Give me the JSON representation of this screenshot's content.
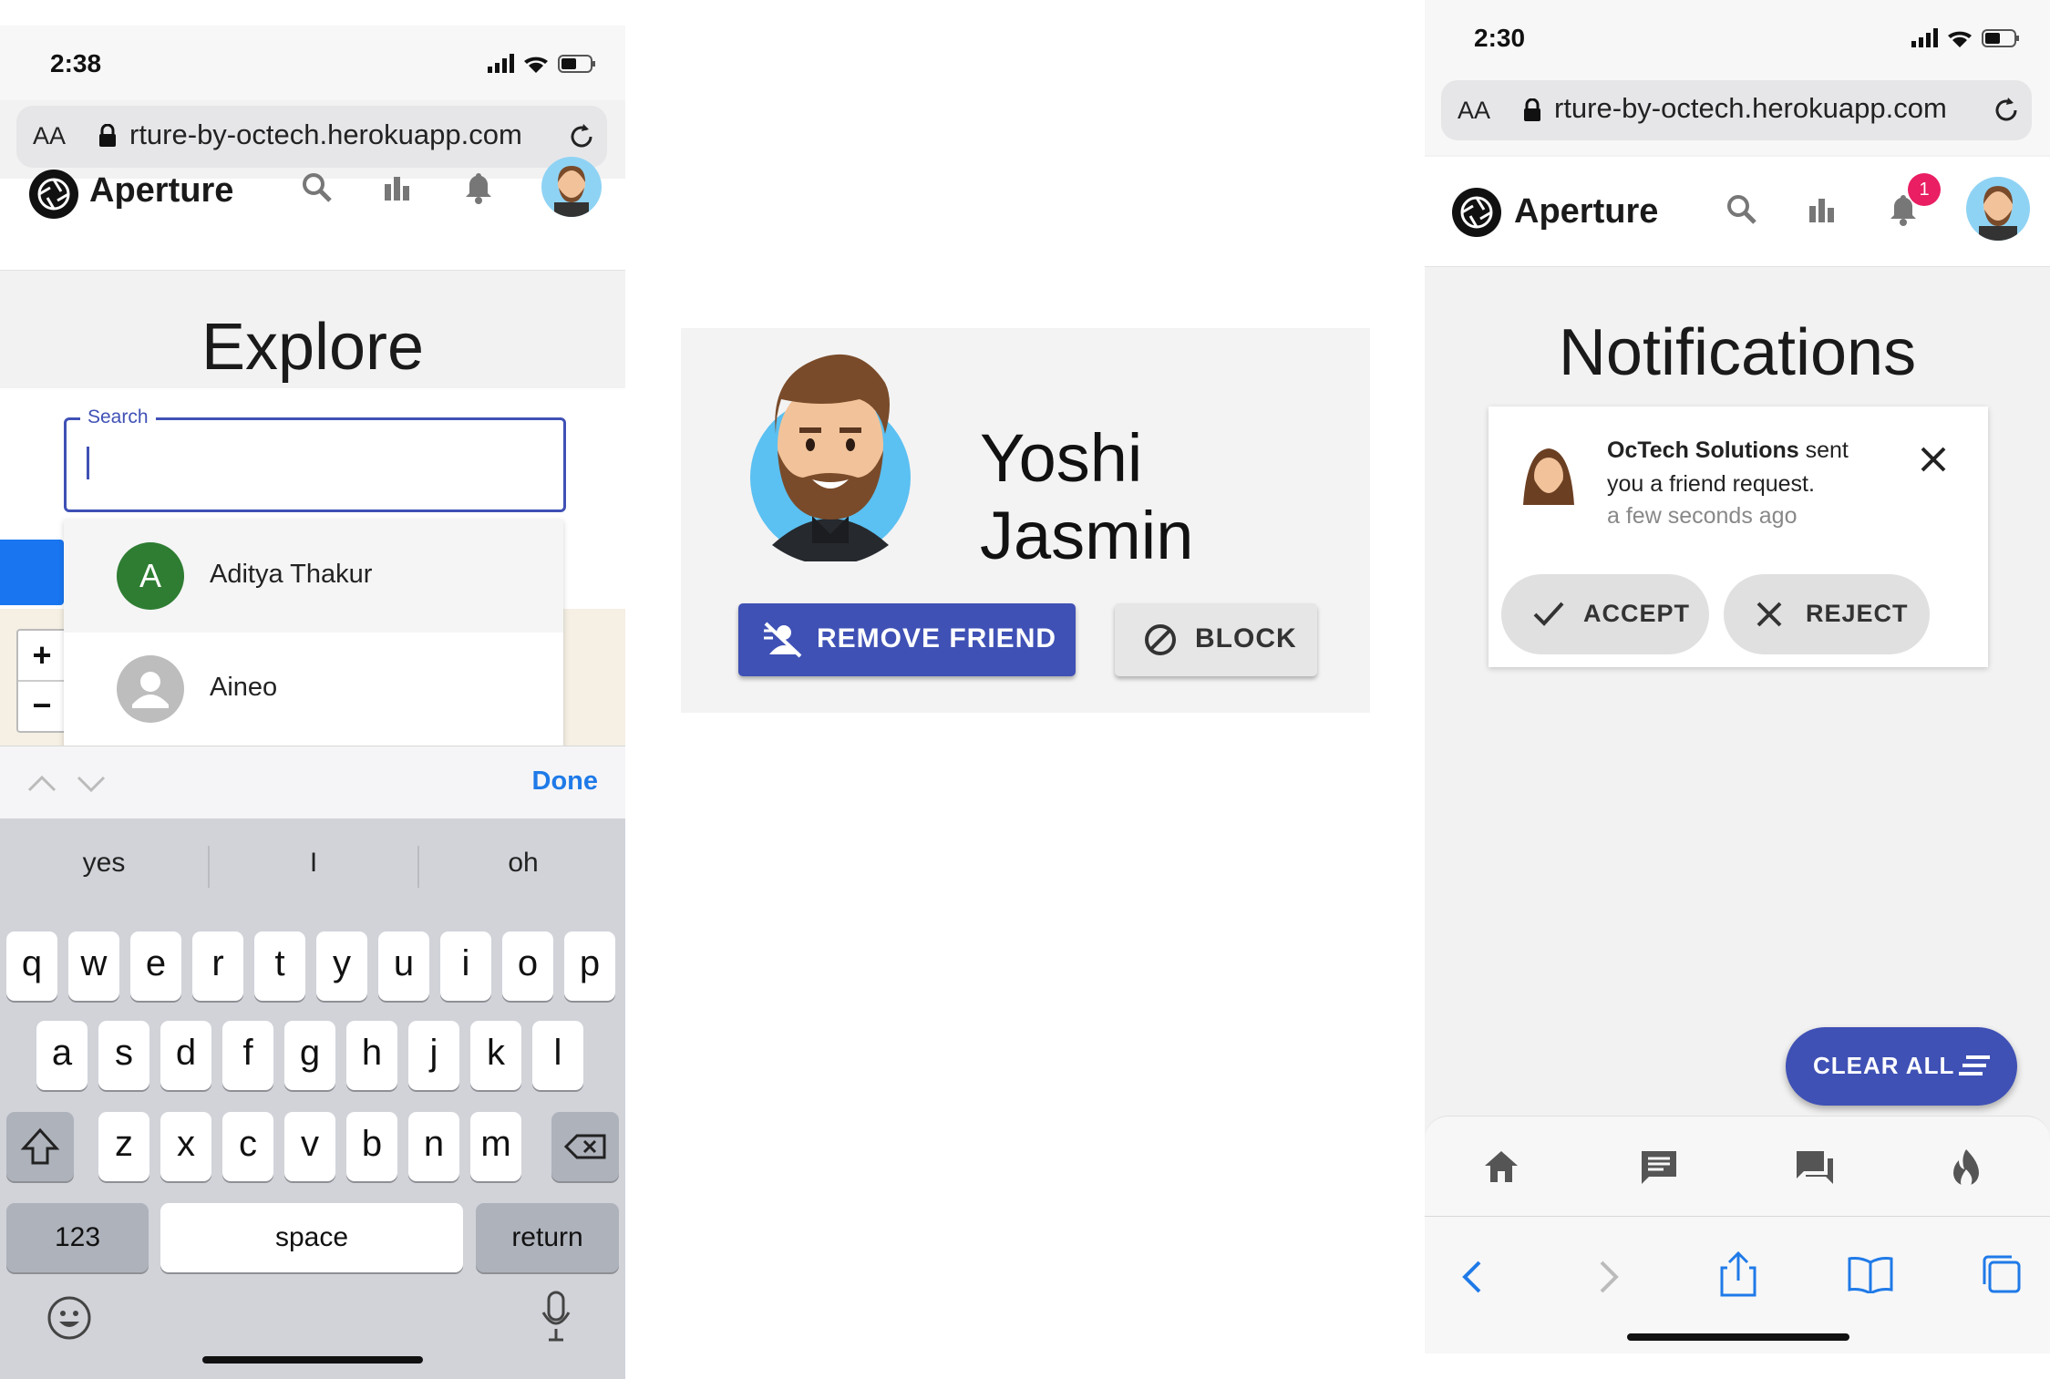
{
  "left_phone": {
    "status_time": "2:38",
    "url_aa": "AA",
    "url_text": "rture-by-octech.herokuapp.com",
    "brand": "Aperture",
    "page_title": "Explore",
    "search": {
      "label": "Search",
      "value": ""
    },
    "suggestions": [
      {
        "initial": "A",
        "name": "Aditya Thakur",
        "color": "#2e7d32"
      },
      {
        "initial": "",
        "name": "Aineo",
        "color": "#bdbdbd"
      }
    ],
    "map_zoom_in": "+",
    "map_zoom_out": "−",
    "keyboard_toolbar": {
      "done_label": "Done"
    },
    "keyboard": {
      "suggestions": [
        "yes",
        "I",
        "oh"
      ],
      "row1": [
        "q",
        "w",
        "e",
        "r",
        "t",
        "y",
        "u",
        "i",
        "o",
        "p"
      ],
      "row2": [
        "a",
        "s",
        "d",
        "f",
        "g",
        "h",
        "j",
        "k",
        "l"
      ],
      "row3": [
        "z",
        "x",
        "c",
        "v",
        "b",
        "n",
        "m"
      ],
      "numbers_label": "123",
      "space_label": "space",
      "return_label": "return"
    }
  },
  "profile_panel": {
    "name": "Yoshi Jasmin",
    "remove_friend_label": "REMOVE FRIEND",
    "block_label": "BLOCK",
    "accent": "#3f51b5"
  },
  "right_phone": {
    "status_time": "2:30",
    "url_aa": "AA",
    "url_text": "rture-by-octech.herokuapp.com",
    "brand": "Aperture",
    "notification_badge": "1",
    "page_title": "Notifications",
    "notification": {
      "sender": "OcTech Solutions",
      "message_part1": " sent",
      "message_part2": "you a friend request.",
      "time": "a few seconds ago",
      "accept_label": "ACCEPT",
      "reject_label": "REJECT"
    },
    "clear_all_label": "CLEAR ALL",
    "bottom_nav": [
      "home-icon",
      "message-icon",
      "chat-icon",
      "fire-icon"
    ],
    "safari_toolbar": [
      "back-icon",
      "forward-icon",
      "share-icon",
      "bookmarks-icon",
      "tabs-icon"
    ]
  }
}
